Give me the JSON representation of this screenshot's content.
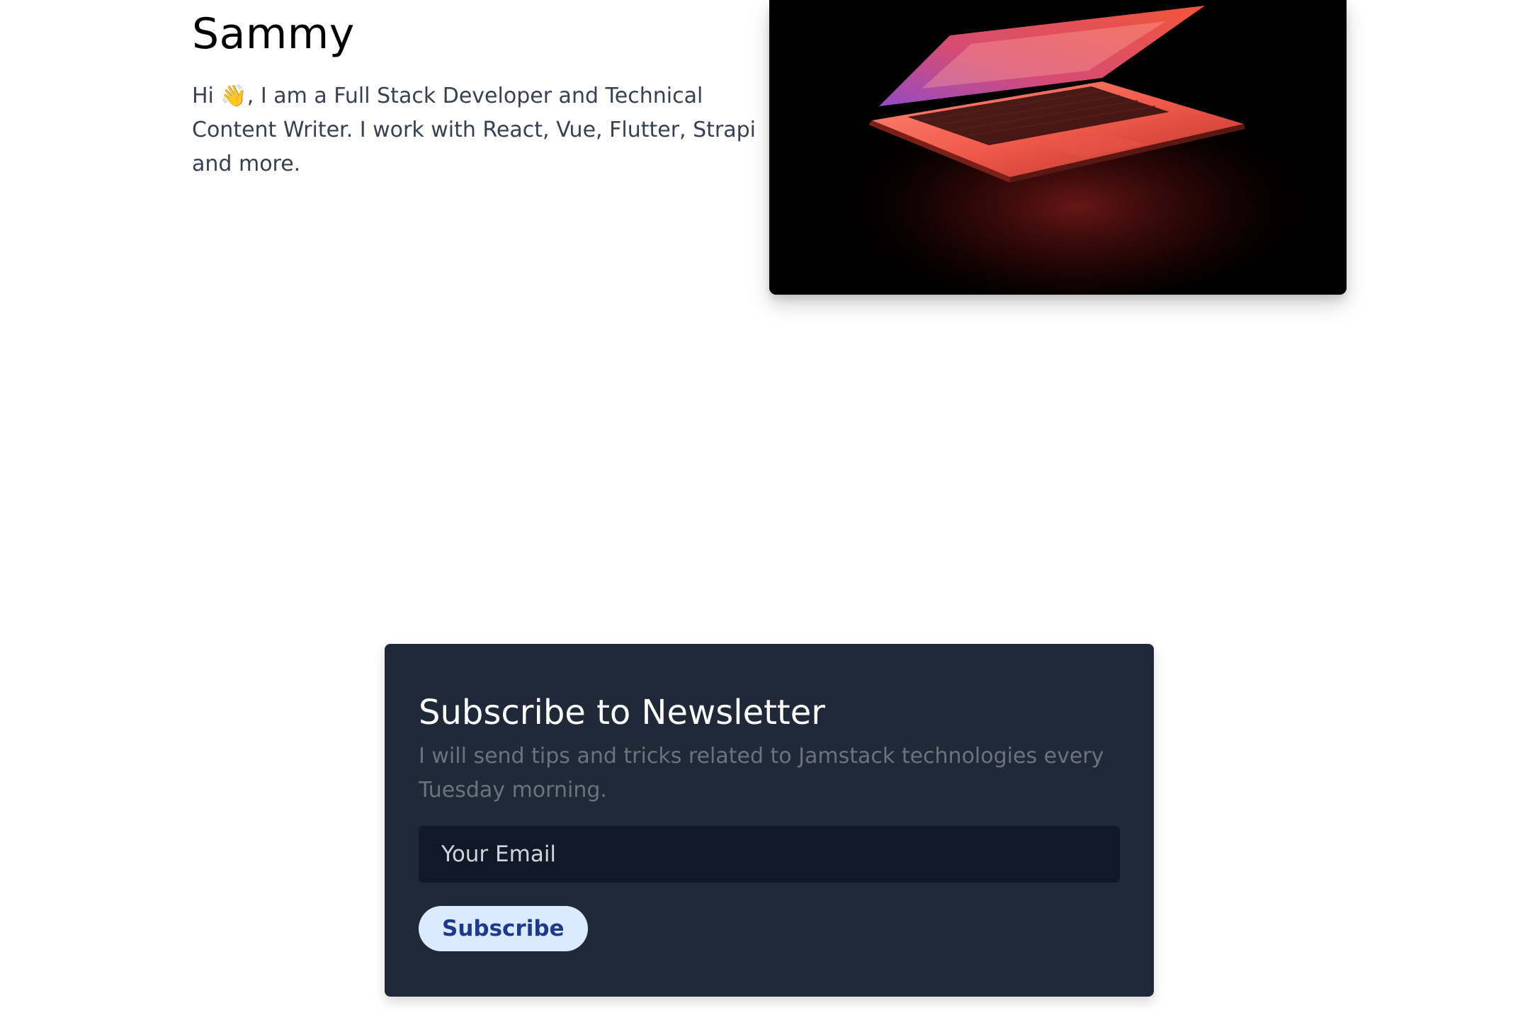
{
  "profile": {
    "name": "Sammy",
    "bio": "Hi 👋, I am a Full Stack Developer and Technical Content Writer. I work with React, Vue, Flutter, Strapi and more."
  },
  "hero_image": {
    "subject": "laptop-photo"
  },
  "newsletter": {
    "title": "Subscribe to Newsletter",
    "description": "I will send tips and tricks related to Jamstack technologies every Tuesday morning.",
    "email_placeholder": "Your Email",
    "email_value": "",
    "subscribe_label": "Subscribe"
  },
  "colors": {
    "card_background": "#1f2937",
    "input_background": "#111827",
    "button_background": "#dbeafe",
    "button_text": "#1e3a8a",
    "muted_text": "#6b7280",
    "body_text": "#374151"
  }
}
